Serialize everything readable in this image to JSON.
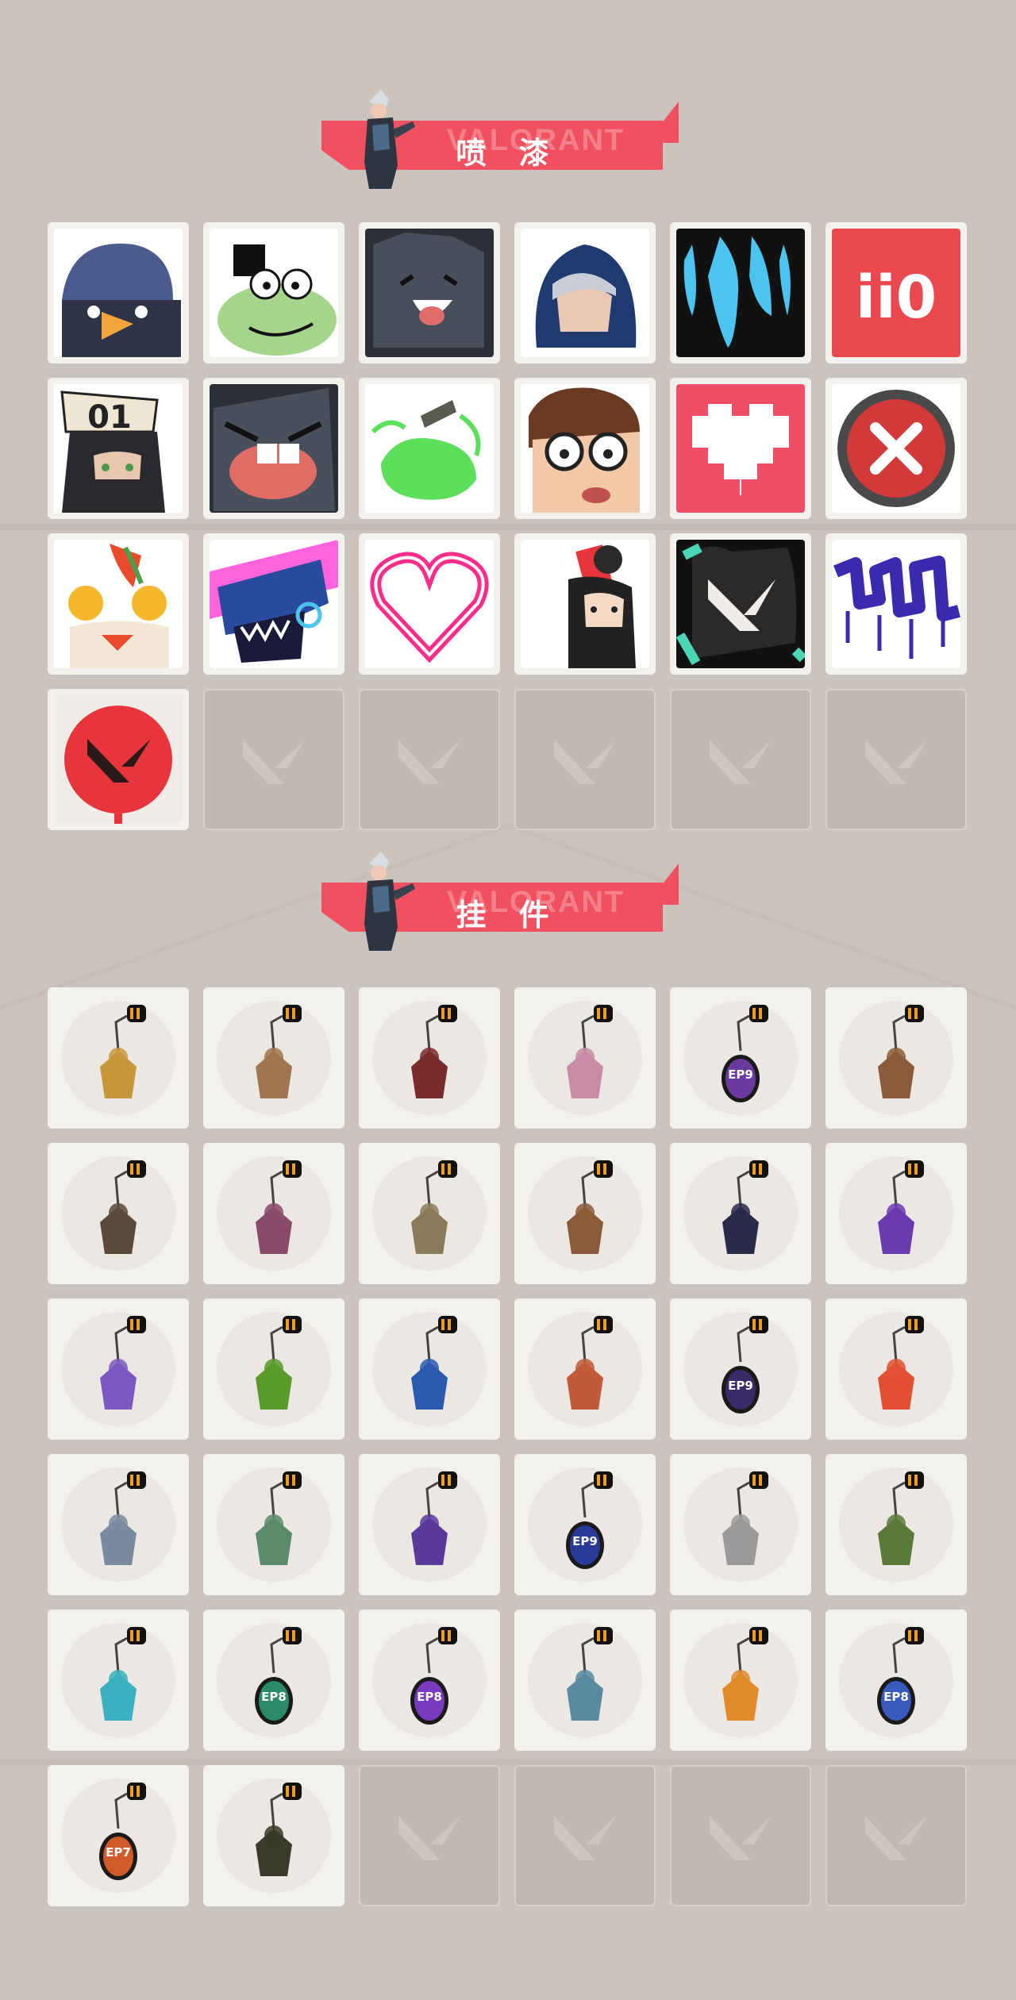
{
  "sections": {
    "sprays": {
      "title": "喷 漆",
      "watermark": "VALORANT",
      "items": [
        {
          "name": "penguin-spray",
          "icon": "penguin-icon"
        },
        {
          "name": "frog-spray",
          "icon": "frog-icon"
        },
        {
          "name": "cat-laugh-spray",
          "icon": "cat-icon"
        },
        {
          "name": "hooded-agent-spray",
          "icon": "hooded-agent-icon"
        },
        {
          "name": "blue-drip-spray",
          "icon": "drip-icon"
        },
        {
          "name": "ii0-spray",
          "icon": "ii0-icon",
          "text": "ii0"
        },
        {
          "name": "agent-01-spray",
          "icon": "agent-sign-icon",
          "text": "01"
        },
        {
          "name": "crying-cat-spray",
          "icon": "crying-cat-icon"
        },
        {
          "name": "green-slime-spray",
          "icon": "slime-icon"
        },
        {
          "name": "glasses-guy-spray",
          "icon": "glasses-icon"
        },
        {
          "name": "pixel-heart-spray",
          "icon": "pixel-heart-icon"
        },
        {
          "name": "x-button-spray",
          "icon": "close-icon"
        },
        {
          "name": "lion-dance-spray",
          "icon": "lion-icon"
        },
        {
          "name": "shark-spray",
          "icon": "shark-icon"
        },
        {
          "name": "neon-heart-spray",
          "icon": "neon-heart-icon"
        },
        {
          "name": "red-card-spray",
          "icon": "referee-icon"
        },
        {
          "name": "valorant-splat-spray",
          "icon": "valorant-logo-icon"
        },
        {
          "name": "graffiti-tag-spray",
          "icon": "graffiti-icon"
        },
        {
          "name": "red-valorant-spray",
          "icon": "red-logo-icon"
        }
      ],
      "empty_count": 5
    },
    "buddies": {
      "title": "挂 件",
      "watermark": "VALORANT",
      "items": [
        {
          "name": "gold-tiger-buddy",
          "color": "#c8973a"
        },
        {
          "name": "sandwich-buddy",
          "color": "#a07650"
        },
        {
          "name": "braided-strap-buddy",
          "color": "#7a2c2c"
        },
        {
          "name": "cupcake-buddy",
          "color": "#c98aa6"
        },
        {
          "name": "ep9-act2-buddy",
          "color": "#6a3aa0",
          "text": "EP9"
        },
        {
          "name": "boxing-bear-buddy",
          "color": "#8a5a3a"
        },
        {
          "name": "weapon-case-buddy",
          "color": "#5a4a3a"
        },
        {
          "name": "agent-figure-buddy",
          "color": "#8a4a6a"
        },
        {
          "name": "robot-hat-buddy",
          "color": "#8a7a5a"
        },
        {
          "name": "crate-cat-buddy",
          "color": "#8a5a3a"
        },
        {
          "name": "tassel-creature-buddy",
          "color": "#2a2a4a"
        },
        {
          "name": "purple-crystal-buddy",
          "color": "#6a3ab0"
        },
        {
          "name": "lava-lamp-buddy",
          "color": "#7a5ac0"
        },
        {
          "name": "green-pager-buddy",
          "color": "#5a9a2a"
        },
        {
          "name": "astronaut-buddy",
          "color": "#2a5ab0"
        },
        {
          "name": "radio-buddy",
          "color": "#c05a3a"
        },
        {
          "name": "ep9-act1-buddy",
          "color": "#3a2a6a",
          "text": "EP9"
        },
        {
          "name": "fruit-skewer-buddy",
          "color": "#e05030"
        },
        {
          "name": "sticker-agent-buddy",
          "color": "#7a8aa0"
        },
        {
          "name": "coffee-maker-buddy",
          "color": "#5a8a6a"
        },
        {
          "name": "purple-canister-buddy",
          "color": "#5a3a9a"
        },
        {
          "name": "ep9-act3-buddy",
          "color": "#2a3a9a",
          "text": "EP9"
        },
        {
          "name": "diamond-tag-buddy",
          "color": "#9a9a9a"
        },
        {
          "name": "green-mask-buddy",
          "color": "#5a7a3a"
        },
        {
          "name": "blue-blade-buddy",
          "color": "#3ab0c0"
        },
        {
          "name": "ep8-green-buddy",
          "color": "#2a8a6a",
          "text": "EP8"
        },
        {
          "name": "ep8-purple-buddy",
          "color": "#7a3ac0",
          "text": "EP8"
        },
        {
          "name": "ufo-buddy",
          "color": "#5a8aa0"
        },
        {
          "name": "orange-lion-buddy",
          "color": "#e08a2a"
        },
        {
          "name": "ep8-blue-buddy",
          "color": "#3a5ac0",
          "text": "EP8"
        },
        {
          "name": "ep7-buddy",
          "color": "#d05a2a",
          "text": "EP7"
        },
        {
          "name": "valorant-black-buddy",
          "color": "#3a3a2a"
        }
      ],
      "empty_count": 4
    }
  }
}
